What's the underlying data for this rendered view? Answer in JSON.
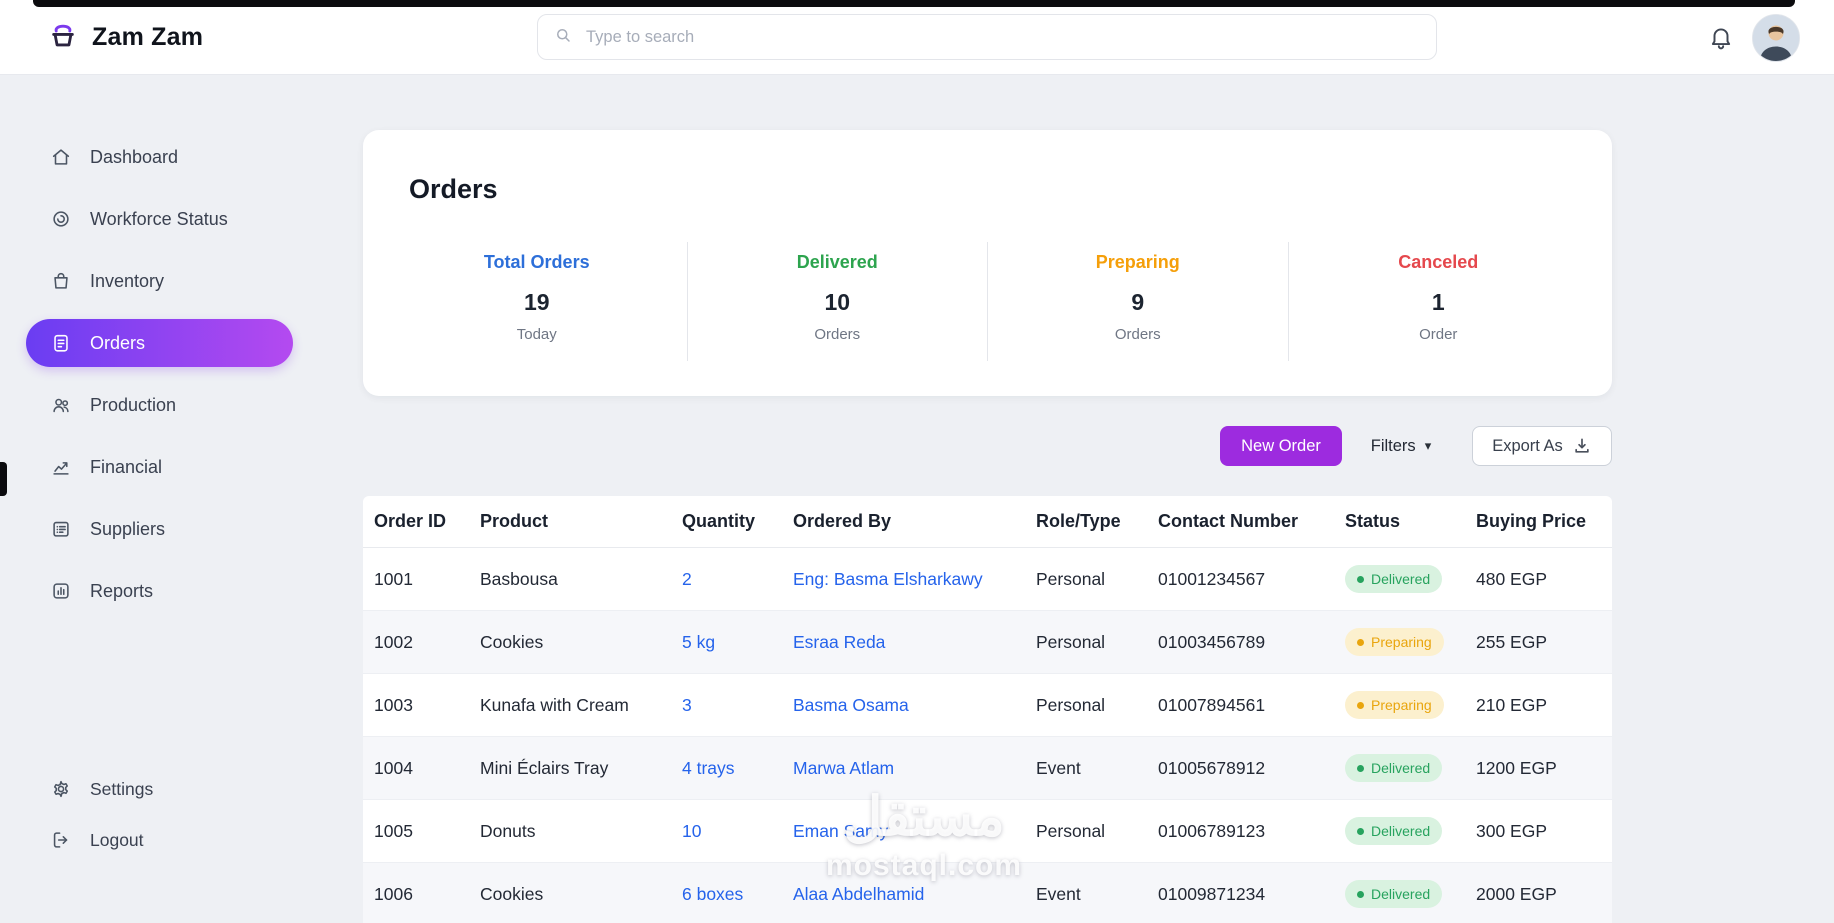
{
  "topbar": {
    "brand": "Zam Zam",
    "search_placeholder": "Type to search"
  },
  "sidebar": {
    "items": [
      {
        "label": "Dashboard",
        "icon": "home-icon",
        "active": false
      },
      {
        "label": "Workforce Status",
        "icon": "workforce-icon",
        "active": false
      },
      {
        "label": "Inventory",
        "icon": "inventory-icon",
        "active": false
      },
      {
        "label": "Orders",
        "icon": "orders-icon",
        "active": true
      },
      {
        "label": "Production",
        "icon": "production-icon",
        "active": false
      },
      {
        "label": "Financial",
        "icon": "financial-icon",
        "active": false
      },
      {
        "label": "Suppliers",
        "icon": "suppliers-icon",
        "active": false
      },
      {
        "label": "Reports",
        "icon": "reports-icon",
        "active": false
      }
    ],
    "footer_items": [
      {
        "label": "Settings",
        "icon": "settings-icon"
      },
      {
        "label": "Logout",
        "icon": "logout-icon"
      }
    ],
    "active_gradient": [
      "#6a3df2",
      "#b44af0"
    ]
  },
  "orders_summary": {
    "title": "Orders",
    "cards": [
      {
        "label": "Total Orders",
        "value": "19",
        "sublabel": "Today",
        "color": "#2d6fd9"
      },
      {
        "label": "Delivered",
        "value": "10",
        "sublabel": "Orders",
        "color": "#2da44e"
      },
      {
        "label": "Preparing",
        "value": "9",
        "sublabel": "Orders",
        "color": "#f59f0a"
      },
      {
        "label": "Canceled",
        "value": "1",
        "sublabel": "Order",
        "color": "#e5484d"
      }
    ]
  },
  "actions": {
    "new_order_label": "New Order",
    "filters_label": "Filters",
    "export_label": "Export As",
    "new_order_color": "#9d2bdf"
  },
  "orders_table": {
    "columns": [
      "Order ID",
      "Product",
      "Quantity",
      "Ordered By",
      "Role/Type",
      "Contact Number",
      "Status",
      "Buying Price"
    ],
    "link_color": "#2563eb",
    "status_styles": {
      "Delivered": {
        "bg": "#d9f2e0",
        "fg": "#27a35e"
      },
      "Preparing": {
        "bg": "#fcf0ce",
        "fg": "#e9a50d"
      }
    },
    "rows": [
      {
        "order_id": "1001",
        "product": "Basbousa",
        "quantity": "2",
        "ordered_by": "Eng: Basma Elsharkawy",
        "role": "Personal",
        "contact": "01001234567",
        "status": "Delivered",
        "price": "480 EGP"
      },
      {
        "order_id": "1002",
        "product": "Cookies",
        "quantity": "5 kg",
        "ordered_by": "Esraa Reda",
        "role": "Personal",
        "contact": "01003456789",
        "status": "Preparing",
        "price": "255 EGP"
      },
      {
        "order_id": "1003",
        "product": "Kunafa with Cream",
        "quantity": "3",
        "ordered_by": "Basma Osama",
        "role": "Personal",
        "contact": "01007894561",
        "status": "Preparing",
        "price": "210 EGP"
      },
      {
        "order_id": "1004",
        "product": "Mini Éclairs Tray",
        "quantity": "4 trays",
        "ordered_by": "Marwa Atlam",
        "role": "Event",
        "contact": "01005678912",
        "status": "Delivered",
        "price": "1200 EGP"
      },
      {
        "order_id": "1005",
        "product": "Donuts",
        "quantity": "10",
        "ordered_by": "Eman Samy",
        "role": "Personal",
        "contact": "01006789123",
        "status": "Delivered",
        "price": "300 EGP"
      },
      {
        "order_id": "1006",
        "product": "Cookies",
        "quantity": "6 boxes",
        "ordered_by": "Alaa Abdelhamid",
        "role": "Event",
        "contact": "01009871234",
        "status": "Delivered",
        "price": "2000 EGP"
      }
    ]
  },
  "watermark": {
    "line1": "مستقل",
    "line2": "mostaql.com"
  }
}
